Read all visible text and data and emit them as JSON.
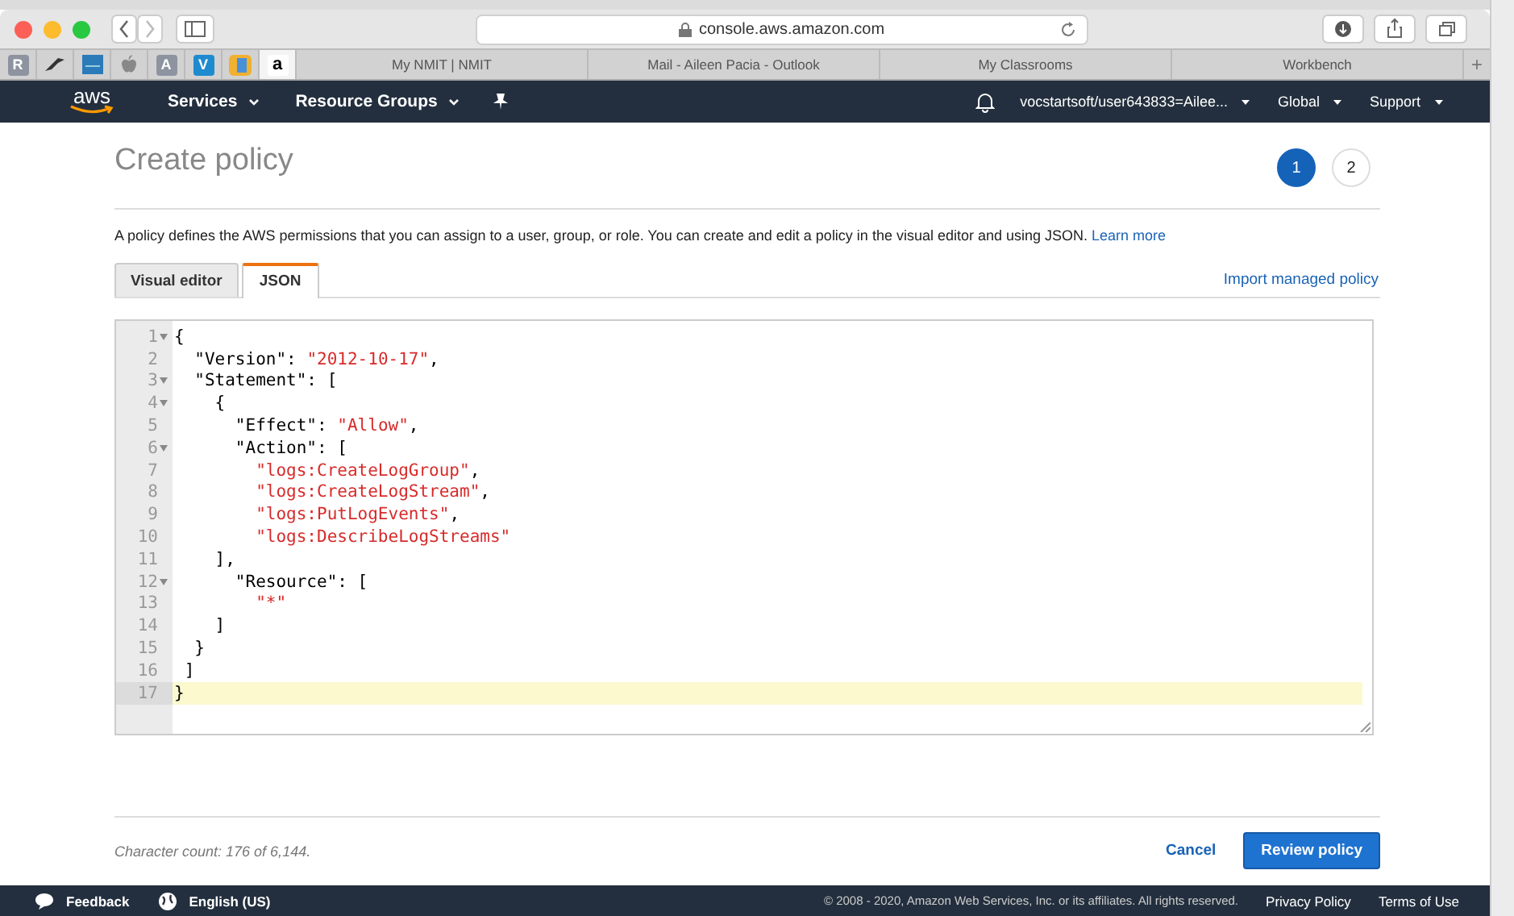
{
  "browser": {
    "address": "console.aws.amazon.com",
    "pinned_tabs": [
      {
        "kind": "letter",
        "text": "R",
        "selected": false
      },
      {
        "kind": "bird",
        "selected": false
      },
      {
        "kind": "square",
        "selected": false
      },
      {
        "kind": "apple",
        "selected": false
      },
      {
        "kind": "letter",
        "text": "A",
        "selected": false
      },
      {
        "kind": "letter",
        "text": "V",
        "selected": false
      },
      {
        "kind": "folder",
        "selected": false
      },
      {
        "kind": "letter",
        "text": "a",
        "selected": true
      }
    ],
    "tabs": [
      {
        "label": "My NMIT | NMIT",
        "selected": false
      },
      {
        "label": "Mail - Aileen Pacia - Outlook",
        "selected": false
      },
      {
        "label": "My Classrooms",
        "selected": false
      },
      {
        "label": "Workbench",
        "selected": false
      }
    ],
    "new_tab": "+"
  },
  "nav": {
    "logo": "aws",
    "menus": [
      "Services",
      "Resource Groups"
    ],
    "account": "vocstartsoft/user643833=Ailee...",
    "region": "Global",
    "support": "Support"
  },
  "page": {
    "title": "Create policy",
    "steps": [
      {
        "label": "1",
        "selected": true
      },
      {
        "label": "2",
        "selected": false
      }
    ],
    "description": "A policy defines the AWS permissions that you can assign to a user, group, or role. You can create and edit a policy in the visual editor and using JSON.",
    "learn_more": "Learn more",
    "tabs": [
      {
        "label": "Visual editor",
        "selected": false
      },
      {
        "label": "JSON",
        "selected": true
      }
    ],
    "import_link": "Import managed policy",
    "editor": {
      "lines": [
        {
          "number": "1",
          "fold": true,
          "selected": false,
          "tokens": [
            {
              "kind": "plain",
              "text": "{"
            }
          ]
        },
        {
          "number": "2",
          "fold": false,
          "selected": false,
          "tokens": [
            {
              "kind": "plain",
              "text": "  \"Version\": "
            },
            {
              "kind": "string",
              "text": "\"2012-10-17\""
            },
            {
              "kind": "plain",
              "text": ","
            }
          ]
        },
        {
          "number": "3",
          "fold": true,
          "selected": false,
          "tokens": [
            {
              "kind": "plain",
              "text": "  \"Statement\": ["
            }
          ]
        },
        {
          "number": "4",
          "fold": true,
          "selected": false,
          "tokens": [
            {
              "kind": "plain",
              "text": "    {"
            }
          ]
        },
        {
          "number": "5",
          "fold": false,
          "selected": false,
          "tokens": [
            {
              "kind": "plain",
              "text": "      \"Effect\": "
            },
            {
              "kind": "string",
              "text": "\"Allow\""
            },
            {
              "kind": "plain",
              "text": ","
            }
          ]
        },
        {
          "number": "6",
          "fold": true,
          "selected": false,
          "tokens": [
            {
              "kind": "plain",
              "text": "      \"Action\": ["
            }
          ]
        },
        {
          "number": "7",
          "fold": false,
          "selected": false,
          "tokens": [
            {
              "kind": "string",
              "text": "        \"logs:CreateLogGroup\""
            },
            {
              "kind": "plain",
              "text": ","
            }
          ]
        },
        {
          "number": "8",
          "fold": false,
          "selected": false,
          "tokens": [
            {
              "kind": "string",
              "text": "        \"logs:CreateLogStream\""
            },
            {
              "kind": "plain",
              "text": ","
            }
          ]
        },
        {
          "number": "9",
          "fold": false,
          "selected": false,
          "tokens": [
            {
              "kind": "string",
              "text": "        \"logs:PutLogEvents\""
            },
            {
              "kind": "plain",
              "text": ","
            }
          ]
        },
        {
          "number": "10",
          "fold": false,
          "selected": false,
          "tokens": [
            {
              "kind": "string",
              "text": "        \"logs:DescribeLogStreams\""
            }
          ]
        },
        {
          "number": "11",
          "fold": false,
          "selected": false,
          "tokens": [
            {
              "kind": "plain",
              "text": "    ],"
            }
          ]
        },
        {
          "number": "12",
          "fold": true,
          "selected": false,
          "tokens": [
            {
              "kind": "plain",
              "text": "      \"Resource\": ["
            }
          ]
        },
        {
          "number": "13",
          "fold": false,
          "selected": false,
          "tokens": [
            {
              "kind": "string",
              "text": "        \"*\""
            }
          ]
        },
        {
          "number": "14",
          "fold": false,
          "selected": false,
          "tokens": [
            {
              "kind": "plain",
              "text": "    ]"
            }
          ]
        },
        {
          "number": "15",
          "fold": false,
          "selected": false,
          "tokens": [
            {
              "kind": "plain",
              "text": "  }"
            }
          ]
        },
        {
          "number": "16",
          "fold": false,
          "selected": false,
          "tokens": [
            {
              "kind": "plain",
              "text": " ]"
            }
          ]
        },
        {
          "number": "17",
          "fold": false,
          "selected": true,
          "tokens": [
            {
              "kind": "plain",
              "text": "}"
            }
          ]
        }
      ]
    },
    "char_count": "Character count: 176 of 6,144.",
    "cancel": "Cancel",
    "review": "Review policy"
  },
  "footer": {
    "feedback": "Feedback",
    "language": "English (US)",
    "copyright": "© 2008 - 2020, Amazon Web Services, Inc. or its affiliates. All rights reserved.",
    "links": [
      "Privacy Policy",
      "Terms of Use"
    ]
  }
}
